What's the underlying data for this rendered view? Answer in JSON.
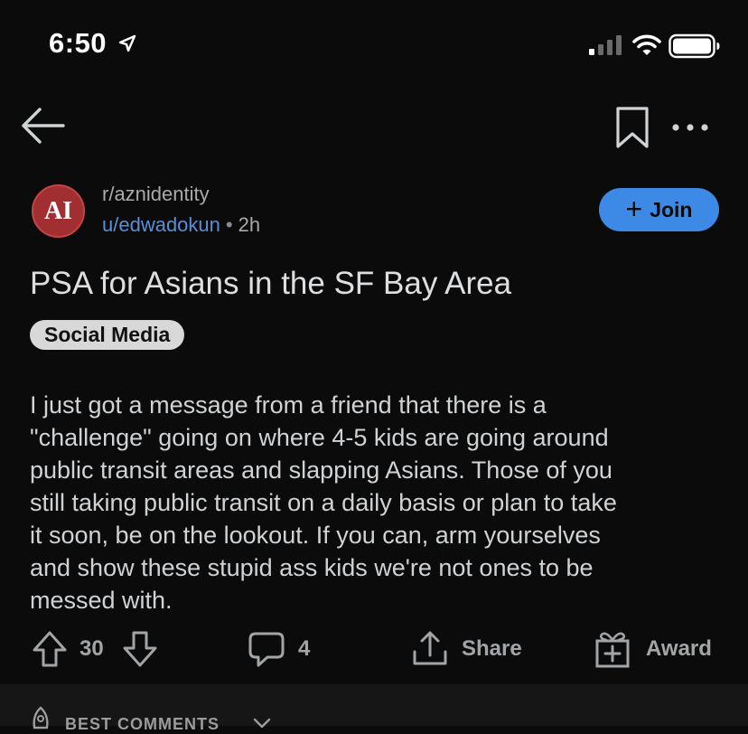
{
  "status_bar": {
    "time": "6:50",
    "icons": [
      "location-arrow-icon",
      "signal-icon",
      "wifi-icon",
      "battery-icon"
    ]
  },
  "nav": {
    "icons": [
      "back-arrow-icon",
      "bookmark-icon",
      "more-options-icon"
    ]
  },
  "post": {
    "avatar_text": "AI",
    "subreddit": "r/aznidentity",
    "author": "u/edwadokun",
    "separator": "•",
    "age": "2h",
    "join_plus": "+",
    "join_label": "Join",
    "title": "PSA for Asians in the SF Bay Area",
    "flair": "Social Media",
    "body_lines": [
      "I just got a message from a friend that there is a",
      "\"challenge\" going on where 4-5 kids are going around",
      "public transit areas and slapping Asians. Those of you",
      "still taking public transit on a daily basis or plan to take",
      "it soon, be on the lookout. If you can, arm yourselves",
      "and show these stupid ass kids we're not ones to be",
      "messed with."
    ]
  },
  "actions": {
    "votes": "30",
    "comments": "4",
    "share_label": "Share",
    "award_label": "Award"
  },
  "comments_bar": {
    "sort_label": "BEST COMMENTS"
  },
  "colors": {
    "background": "#0b0b0b",
    "join_button": "#3d8ae6",
    "author_link": "#5a8fd6",
    "avatar": "#a12f31",
    "flair_bg": "#d8d8d8"
  }
}
